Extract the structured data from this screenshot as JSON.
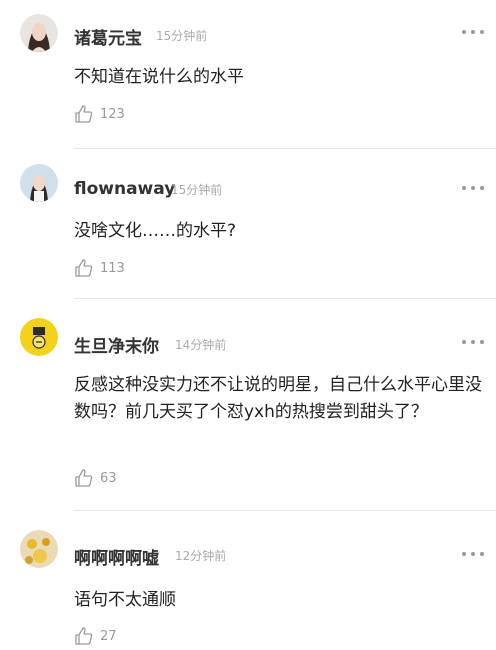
{
  "comments": [
    {
      "username": "诸葛元宝",
      "time": "15分钟前",
      "text": "不知道在说什么的水平",
      "likes": "123",
      "avatar_icon": "woman-portrait-avatar"
    },
    {
      "username": "flownaway",
      "time": "15分钟前",
      "text": "没啥文化……的水平?",
      "likes": "113",
      "avatar_icon": "woman-profile-avatar"
    },
    {
      "username": "生旦净末你",
      "time": "14分钟前",
      "text": "反感这种没实力还不让说的明星，自己什么水平心里没数吗？前几天买了个怼yxh的热搜尝到甜头了？",
      "likes": "63",
      "avatar_icon": "yellow-cartoon-avatar"
    },
    {
      "username": "啊啊啊啊嘘",
      "time": "12分钟前",
      "text": "语句不太通顺",
      "likes": "27",
      "avatar_icon": "yellow-pattern-avatar"
    }
  ],
  "icons": {
    "like": "thumbs-up-icon",
    "more": "more-options-icon"
  },
  "colors": {
    "username": "#333333",
    "meta": "#aaaaaa",
    "divider": "#e8e8e8"
  }
}
